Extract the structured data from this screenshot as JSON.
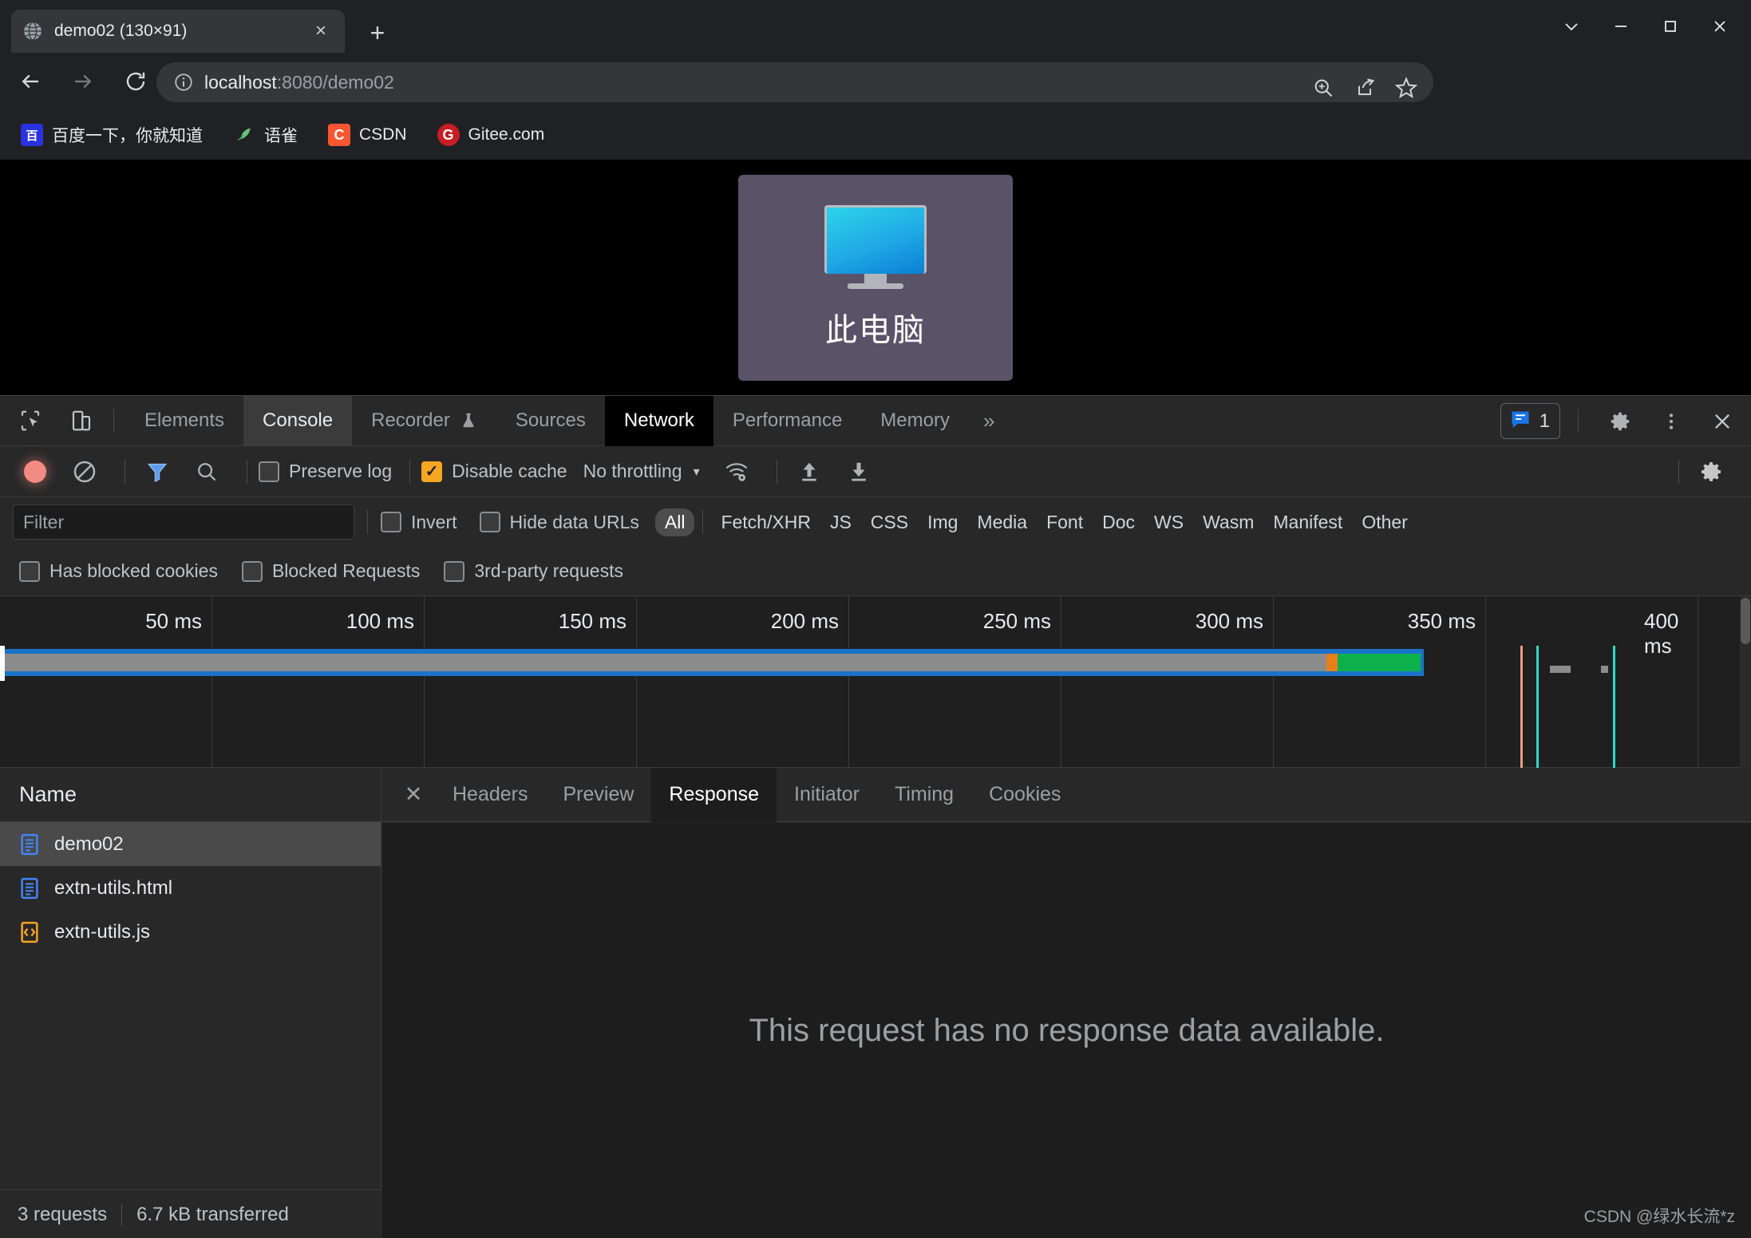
{
  "browser": {
    "tab": {
      "title": "demo02 (130×91)",
      "favicon": "globe-icon",
      "close": "×"
    },
    "new_tab": "+",
    "window_controls": {
      "tab_search": "tab-search-icon",
      "minimize": "—",
      "maximize": "□",
      "close": "✕"
    },
    "nav": {
      "back": "←",
      "forward": "→",
      "reload": "⟳"
    },
    "omnibox": {
      "site_info_icon": "info-circle-icon",
      "url_host": "localhost",
      "url_rest": ":8080/demo02",
      "full_url": "localhost:8080/demo02",
      "actions": [
        "zoom-in-icon",
        "share-icon",
        "bookmark-star-icon"
      ]
    },
    "toolbar_icons": [
      "vue-devtools-icon",
      "extensions-puzzle-icon",
      "side-panel-icon",
      "profile-avatar-icon",
      "chrome-menu-icon"
    ],
    "bookmarks": [
      {
        "label": "百度一下，你就知道",
        "icon": "baidu-icon",
        "icon_text": "百",
        "icon_bg": "#2932e1",
        "icon_fg": "#ffffff"
      },
      {
        "label": "语雀",
        "icon": "yuque-icon",
        "icon_text": "",
        "icon_bg": "transparent",
        "icon_fg": "#5fc48d"
      },
      {
        "label": "CSDN",
        "icon": "csdn-icon",
        "icon_text": "C",
        "icon_bg": "#fc5531",
        "icon_fg": "#ffffff"
      },
      {
        "label": "Gitee.com",
        "icon": "gitee-icon",
        "icon_text": "G",
        "icon_bg": "#c71d23",
        "icon_fg": "#ffffff"
      }
    ]
  },
  "page": {
    "desktop_icon_label": "此电脑",
    "desktop_icon_name": "this-pc-icon",
    "tile_bg": "#5a5368",
    "background": "#000000"
  },
  "devtools": {
    "left_icons": [
      "inspect-element-icon",
      "device-toolbar-icon"
    ],
    "tabs": [
      {
        "label": "Elements",
        "state": "normal"
      },
      {
        "label": "Console",
        "state": "hover"
      },
      {
        "label": "Recorder",
        "state": "normal",
        "suffix_icon": "flask-icon"
      },
      {
        "label": "Sources",
        "state": "normal"
      },
      {
        "label": "Network",
        "state": "active"
      },
      {
        "label": "Performance",
        "state": "normal"
      },
      {
        "label": "Memory",
        "state": "normal"
      }
    ],
    "more_tabs": "»",
    "message_count": "1",
    "message_icon": "console-message-icon",
    "right_icons": [
      "settings-gear-icon",
      "more-options-icon",
      "close-devtools-icon"
    ],
    "network_toolbar": {
      "record_tooltip": "record-button",
      "clear_icon": "clear-icon",
      "filter_icon": "filter-funnel-icon",
      "search_icon": "search-icon",
      "preserve_log": {
        "label": "Preserve log",
        "checked": false
      },
      "disable_cache": {
        "label": "Disable cache",
        "checked": true
      },
      "throttling": {
        "value": "No throttling",
        "caret": "▾"
      },
      "network_conditions_icon": "wifi-settings-icon",
      "upload_icon": "import-har-icon",
      "download_icon": "export-har-icon",
      "settings_icon": "network-settings-gear-icon"
    },
    "filter_bar": {
      "placeholder": "Filter",
      "value": "",
      "invert": {
        "label": "Invert",
        "checked": false
      },
      "hide_data_urls": {
        "label": "Hide data URLs",
        "checked": false
      },
      "types": [
        "All",
        "Fetch/XHR",
        "JS",
        "CSS",
        "Img",
        "Media",
        "Font",
        "Doc",
        "WS",
        "Wasm",
        "Manifest",
        "Other"
      ],
      "selected_type": "All"
    },
    "filter_bar2": [
      {
        "label": "Has blocked cookies",
        "checked": false
      },
      {
        "label": "Blocked Requests",
        "checked": false
      },
      {
        "label": "3rd-party requests",
        "checked": false
      }
    ],
    "overview": {
      "ticks": [
        "50 ms",
        "100 ms",
        "150 ms",
        "200 ms",
        "250 ms",
        "300 ms",
        "350 ms",
        "400 ms"
      ],
      "band_color": "#1a73c8",
      "bar_color": "#8c8c8c",
      "orange_color": "#e8801a",
      "green_color": "#0db14b",
      "dom_content_loaded_color": "#e8a087",
      "load_color": "#2fd9c4"
    },
    "requests": {
      "column_header": "Name",
      "rows": [
        {
          "name": "demo02",
          "icon": "document-icon",
          "selected": true
        },
        {
          "name": "extn-utils.html",
          "icon": "document-icon",
          "selected": false
        },
        {
          "name": "extn-utils.js",
          "icon": "script-icon",
          "selected": false
        }
      ],
      "status": {
        "count": "3 requests",
        "transferred": "6.7 kB transferred"
      }
    },
    "detail": {
      "close": "✕",
      "tabs": [
        "Headers",
        "Preview",
        "Response",
        "Initiator",
        "Timing",
        "Cookies"
      ],
      "active_tab": "Response",
      "empty_message": "This request has no response data available."
    }
  },
  "watermark": "CSDN @绿水长流*z"
}
